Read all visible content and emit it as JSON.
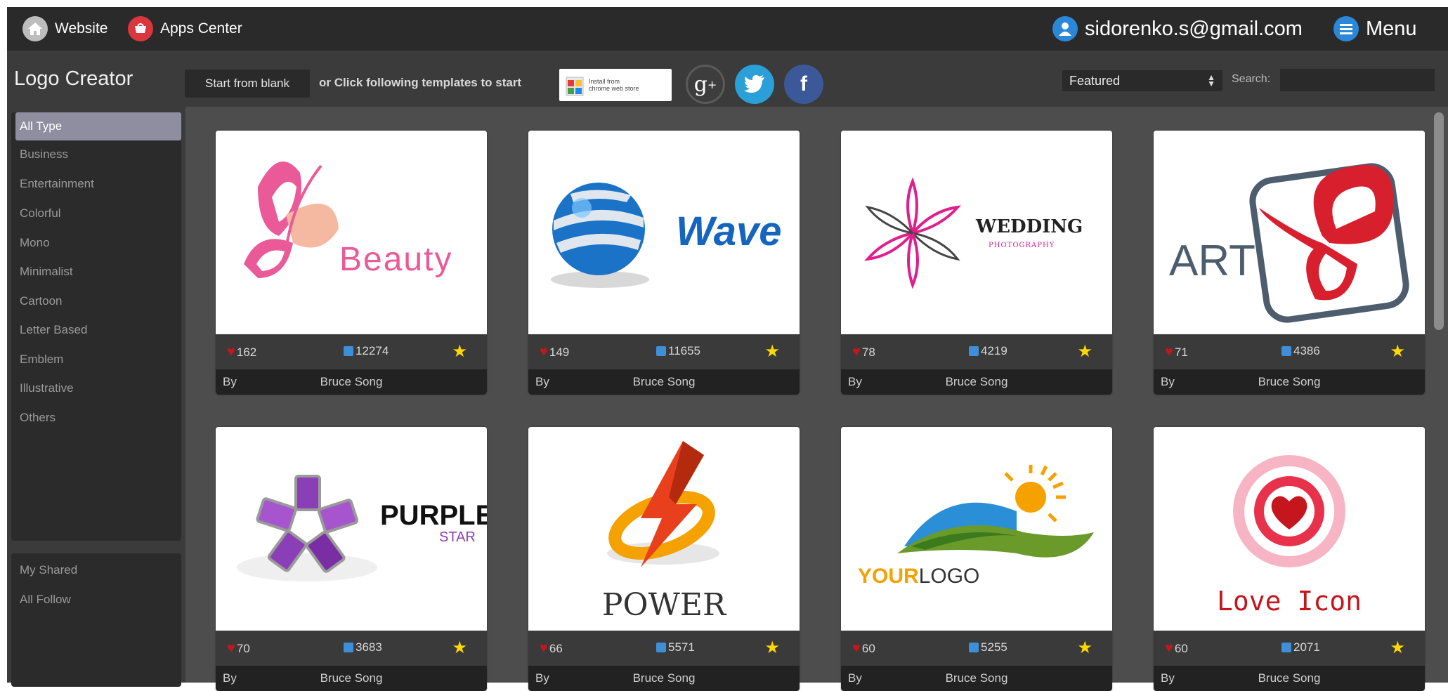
{
  "topbar": {
    "website": "Website",
    "apps_center": "Apps Center",
    "email": "sidorenko.s@gmail.com",
    "menu": "Menu"
  },
  "toolbar": {
    "title": "Logo Creator",
    "start_blank": "Start from blank",
    "hint": "or Click following templates to start",
    "install_badge_line1": "Install from",
    "install_badge_line2": "chrome web store",
    "sort_selected": "Featured",
    "search_label": "Search:",
    "search_value": ""
  },
  "sidebar": {
    "items": [
      {
        "label": "All Type",
        "active": true
      },
      {
        "label": "Business"
      },
      {
        "label": "Entertainment"
      },
      {
        "label": "Colorful"
      },
      {
        "label": "Mono"
      },
      {
        "label": "Minimalist"
      },
      {
        "label": "Cartoon"
      },
      {
        "label": "Letter Based"
      },
      {
        "label": "Emblem"
      },
      {
        "label": "Illustrative"
      },
      {
        "label": "Others"
      }
    ],
    "extra": [
      {
        "label": "My Shared"
      },
      {
        "label": "All Follow"
      }
    ]
  },
  "cards": [
    {
      "logo": "Beauty",
      "likes": "162",
      "edits": "12274",
      "by": "By",
      "author": "Bruce Song"
    },
    {
      "logo": "Wave",
      "likes": "149",
      "edits": "11655",
      "by": "By",
      "author": "Bruce Song"
    },
    {
      "logo": "WEDDING",
      "logo_sub": "PHOTOGRAPHY",
      "likes": "78",
      "edits": "4219",
      "by": "By",
      "author": "Bruce Song"
    },
    {
      "logo": "ART",
      "likes": "71",
      "edits": "4386",
      "by": "By",
      "author": "Bruce Song"
    },
    {
      "logo": "PURPLE",
      "logo_sub": "STAR",
      "likes": "70",
      "edits": "3683",
      "by": "By",
      "author": "Bruce Song"
    },
    {
      "logo": "POWER",
      "likes": "66",
      "edits": "5571",
      "by": "By",
      "author": "Bruce Song"
    },
    {
      "logo": "YOUR",
      "logo_sub": "LOGO",
      "likes": "60",
      "edits": "5255",
      "by": "By",
      "author": "Bruce Song"
    },
    {
      "logo": "Love Icon",
      "likes": "60",
      "edits": "2071",
      "by": "By",
      "author": "Bruce Song"
    }
  ],
  "colors": {
    "topbar": "#2a2a2a",
    "toolbar": "#3b3b3b",
    "sidebar_active": "#8e8ea0",
    "heart": "#c4161c",
    "star": "#ffd800"
  }
}
